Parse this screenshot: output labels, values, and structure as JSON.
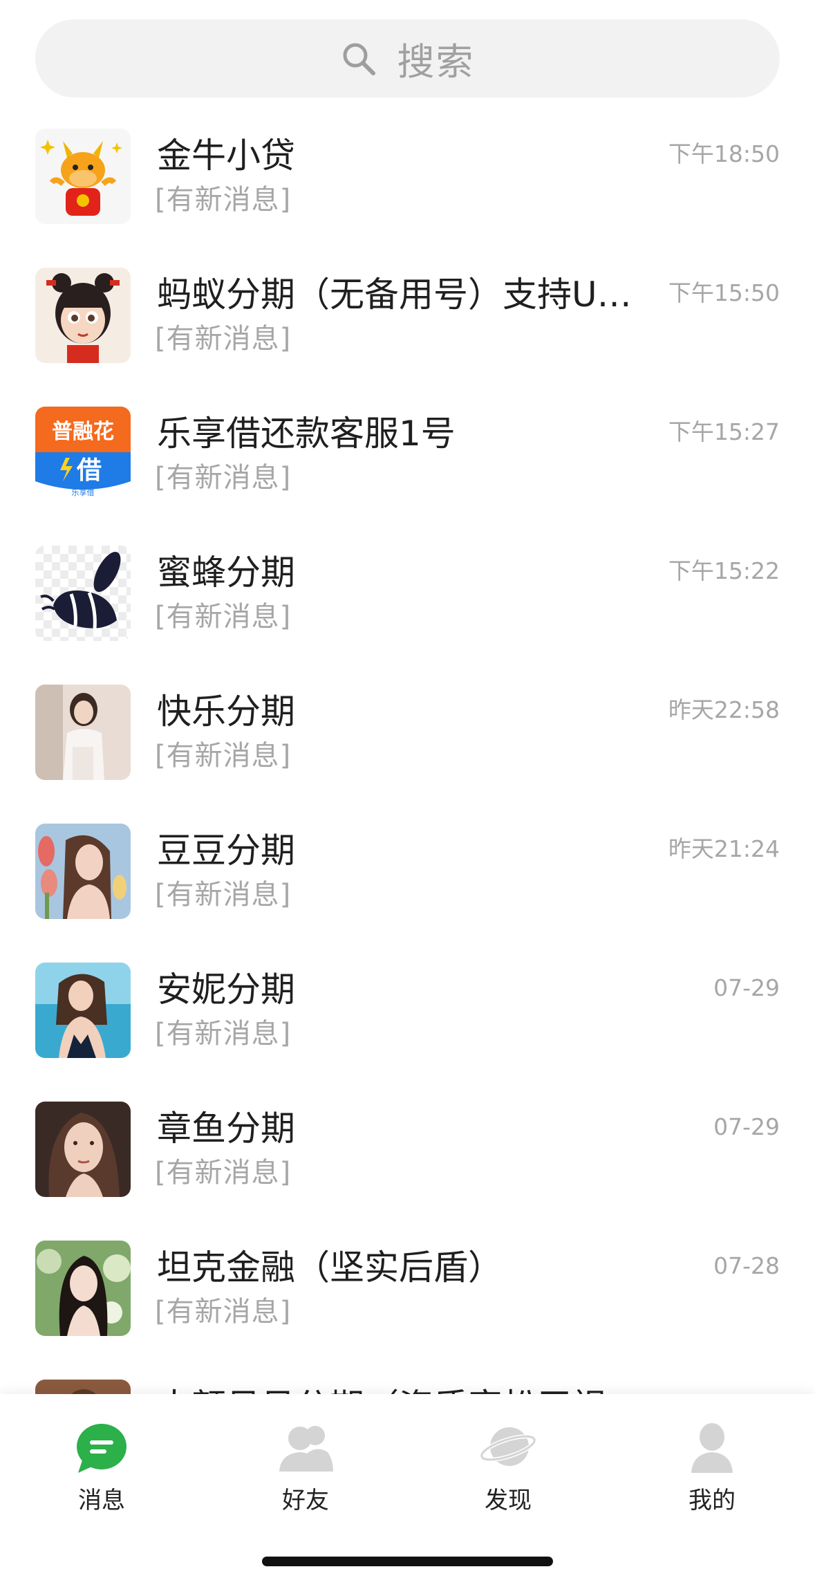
{
  "search": {
    "placeholder": "搜索"
  },
  "chats": [
    {
      "name": "金牛小贷",
      "preview": "[有新消息]",
      "time": "下午18:50",
      "avatar": "cartoon-ox-avatar"
    },
    {
      "name": "蚂蚁分期（无备用号）支持U…",
      "preview": "[有新消息]",
      "time": "下午15:50",
      "avatar": "cartoon-girl-avatar"
    },
    {
      "name": "乐享借还款客服1号",
      "preview": "[有新消息]",
      "time": "下午15:27",
      "avatar": "puronghua-logo-avatar",
      "avatar_text_top": "普融花",
      "avatar_text_mid": "借",
      "avatar_text_bottom": "乐享借"
    },
    {
      "name": "蜜蜂分期",
      "preview": "[有新消息]",
      "time": "下午15:22",
      "avatar": "bee-logo-avatar"
    },
    {
      "name": "快乐分期",
      "preview": "[有新消息]",
      "time": "昨天22:58",
      "avatar": "photo-avatar"
    },
    {
      "name": "豆豆分期",
      "preview": "[有新消息]",
      "time": "昨天21:24",
      "avatar": "photo-avatar"
    },
    {
      "name": "安妮分期",
      "preview": "[有新消息]",
      "time": "07-29",
      "avatar": "photo-avatar"
    },
    {
      "name": "章鱼分期",
      "preview": "[有新消息]",
      "time": "07-29",
      "avatar": "photo-avatar"
    },
    {
      "name": "坦克金融（坚实后盾）",
      "preview": "[有新消息]",
      "time": "07-28",
      "avatar": "photo-avatar"
    },
    {
      "name": "大额贝贝分期（资质宽松无视负债",
      "preview": "",
      "time": "",
      "avatar": "photo-avatar"
    }
  ],
  "tabs": [
    {
      "label": "消息",
      "icon": "chat-bubble-icon",
      "active": true
    },
    {
      "label": "好友",
      "icon": "friends-icon",
      "active": false
    },
    {
      "label": "发现",
      "icon": "planet-icon",
      "active": false
    },
    {
      "label": "我的",
      "icon": "person-icon",
      "active": false
    }
  ],
  "colors": {
    "accent": "#2bb04a",
    "inactive_icon": "#d4d4d4",
    "text": "#1f1f1f",
    "subtext": "#a6a6a6",
    "search_bg": "#f2f2f2"
  }
}
